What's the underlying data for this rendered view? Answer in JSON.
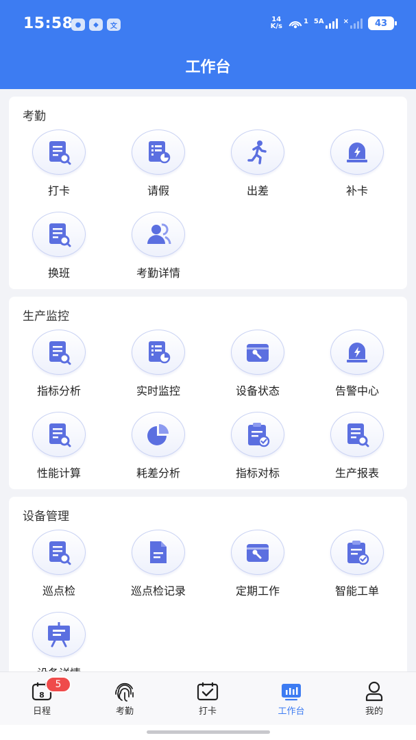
{
  "status_bar": {
    "time": "15:58",
    "network_speed_value": "14",
    "network_speed_unit": "K/s",
    "hotspot_count": "1",
    "network_type": "5A",
    "sim2_mark": "×",
    "battery": "43"
  },
  "header": {
    "title": "工作台"
  },
  "sections": [
    {
      "title": "考勤",
      "items": [
        {
          "label": "打卡",
          "icon": "report-search-icon"
        },
        {
          "label": "请假",
          "icon": "list-chart-icon"
        },
        {
          "label": "出差",
          "icon": "running-person-icon"
        },
        {
          "label": "补卡",
          "icon": "alarm-lightning-icon"
        },
        {
          "label": "换班",
          "icon": "report-search-icon"
        },
        {
          "label": "考勤详情",
          "icon": "users-icon"
        }
      ]
    },
    {
      "title": "生产监控",
      "items": [
        {
          "label": "指标分析",
          "icon": "report-search-icon"
        },
        {
          "label": "实时监控",
          "icon": "list-chart-icon"
        },
        {
          "label": "设备状态",
          "icon": "toolbox-wrench-icon"
        },
        {
          "label": "告警中心",
          "icon": "alarm-lightning-icon"
        },
        {
          "label": "性能计算",
          "icon": "report-search-icon"
        },
        {
          "label": "耗差分析",
          "icon": "pie-chart-icon"
        },
        {
          "label": "指标对标",
          "icon": "clipboard-check-icon"
        },
        {
          "label": "生产报表",
          "icon": "report-search-icon"
        }
      ]
    },
    {
      "title": "设备管理",
      "items": [
        {
          "label": "巡点检",
          "icon": "report-search-icon"
        },
        {
          "label": "巡点检记录",
          "icon": "document-icon"
        },
        {
          "label": "定期工作",
          "icon": "toolbox-wrench-icon"
        },
        {
          "label": "智能工单",
          "icon": "clipboard-check-icon"
        },
        {
          "label": "设备详情",
          "icon": "presentation-board-icon"
        }
      ]
    }
  ],
  "tabbar": {
    "items": [
      {
        "label": "日程",
        "icon": "calendar-icon",
        "calendar_day": "8",
        "badge": "5"
      },
      {
        "label": "考勤",
        "icon": "fingerprint-icon"
      },
      {
        "label": "打卡",
        "icon": "calendar-check-icon"
      },
      {
        "label": "工作台",
        "icon": "dashboard-icon",
        "active": true
      },
      {
        "label": "我的",
        "icon": "user-icon"
      }
    ]
  },
  "colors": {
    "primary": "#3d7cf2",
    "icon_fill": "#5b6fe0",
    "badge": "#ef4b4b"
  }
}
